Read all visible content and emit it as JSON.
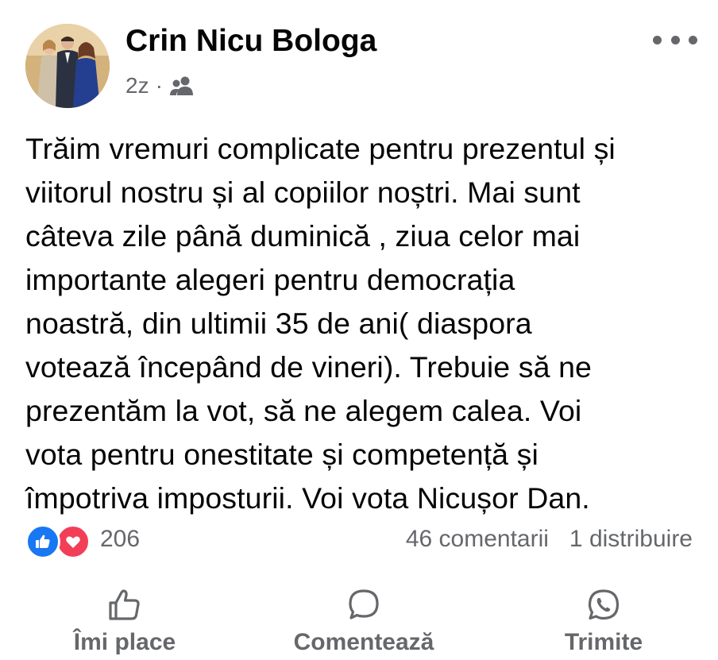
{
  "post": {
    "author": "Crin Nicu Bologa",
    "time": "2z",
    "separator": "·",
    "audience_icon": "friends-icon",
    "more_icon": "more-options-icon",
    "message": "Trăim vremuri complicate pentru prezentul și\nviitorul nostru și al copiilor noștri. Mai sunt\ncâteva zile până duminică , ziua celor mai\nimportante alegeri pentru democrația\nnoastră, din ultimii 35 de ani( diaspora\nvotează începând de vineri). Trebuie să ne\nprezentăm la vot, să ne alegem calea. Voi\nvota pentru onestitate și competență și\nîmpotriva imposturii. Voi vota Nicușor Dan.",
    "reactions": {
      "count": "206",
      "types": [
        "like",
        "love"
      ]
    },
    "comments": "46 comentarii",
    "shares": "1 distribuire"
  },
  "actions": {
    "like": "Îmi place",
    "comment": "Comentează",
    "share": "Trimite"
  },
  "colors": {
    "text": "#050505",
    "secondary": "#65676b",
    "like_blue": "#1877f2",
    "love_red": "#f33e58"
  }
}
